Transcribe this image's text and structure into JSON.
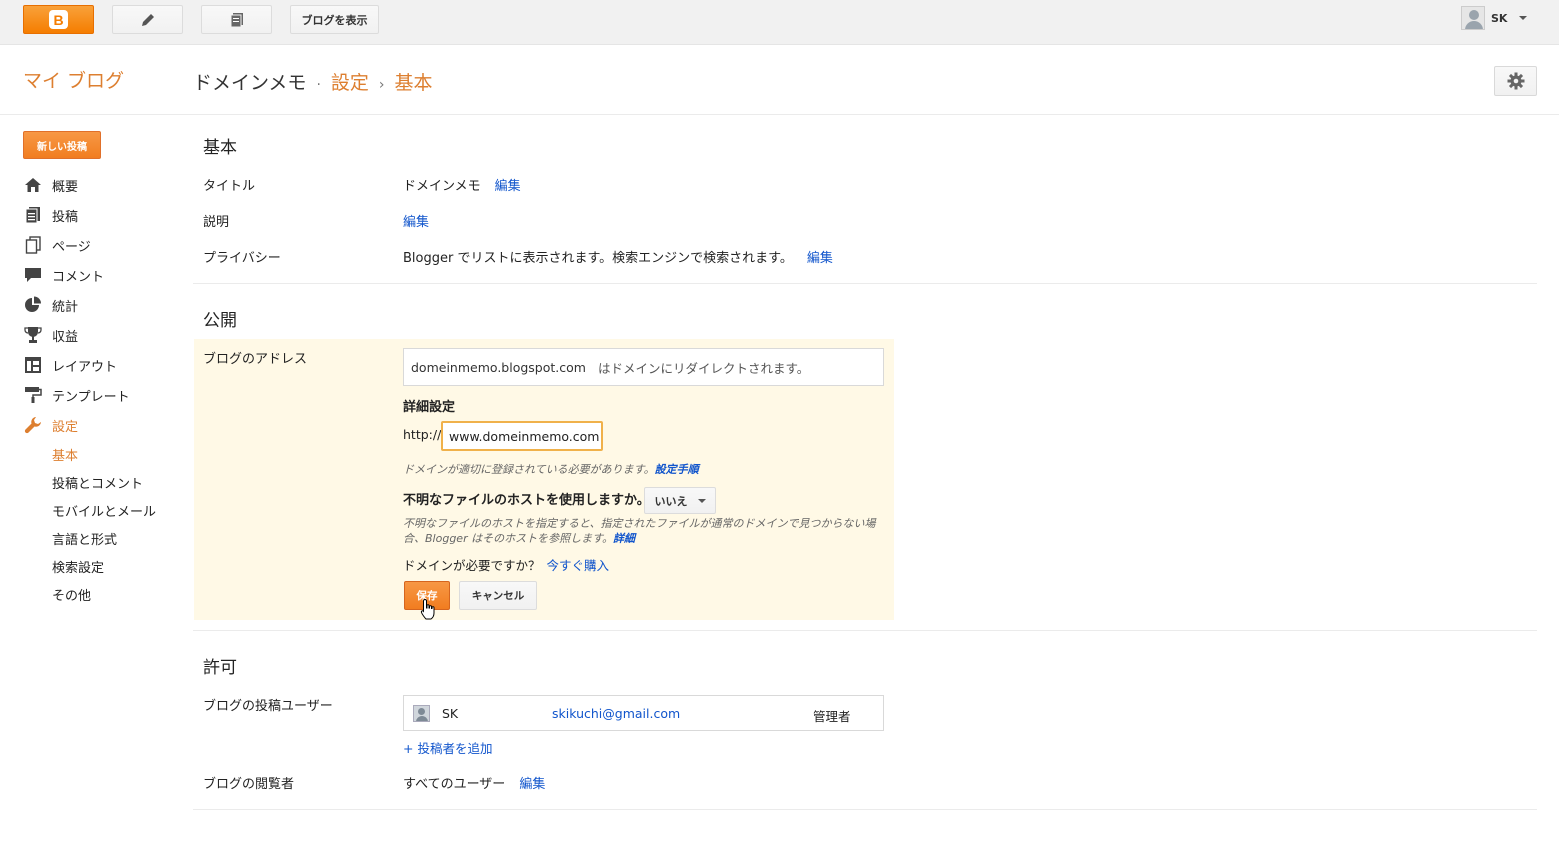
{
  "topbar": {
    "logo_letter": "B",
    "view_blog_label": "ブログを表示",
    "user_name": "SK"
  },
  "header": {
    "my_blog": "マイ ブログ",
    "blog_name": "ドメインメモ",
    "dot": "·",
    "settings": "設定",
    "arrow": "›",
    "current": "基本"
  },
  "sidebar": {
    "new_post": "新しい投稿",
    "items": [
      {
        "label": "概要",
        "icon": "home-icon"
      },
      {
        "label": "投稿",
        "icon": "posts-icon"
      },
      {
        "label": "ページ",
        "icon": "pages-icon"
      },
      {
        "label": "コメント",
        "icon": "comment-icon"
      },
      {
        "label": "統計",
        "icon": "stats-icon"
      },
      {
        "label": "収益",
        "icon": "trophy-icon"
      },
      {
        "label": "レイアウト",
        "icon": "layout-icon"
      },
      {
        "label": "テンプレート",
        "icon": "template-icon"
      },
      {
        "label": "設定",
        "icon": "wrench-icon"
      }
    ],
    "sub_items": [
      "基本",
      "投稿とコメント",
      "モバイルとメール",
      "言語と形式",
      "検索設定",
      "その他"
    ]
  },
  "basic": {
    "title": "基本",
    "title_label": "タイトル",
    "title_value": "ドメインメモ",
    "edit": "編集",
    "description_label": "説明",
    "privacy_label": "プライバシー",
    "privacy_value": "Blogger でリストに表示されます。検索エンジンで検索されます。"
  },
  "publish": {
    "title": "公開",
    "address_label": "ブログのアドレス",
    "address_value": "domeinmemo.blogspot.com",
    "address_note": "はドメインにリダイレクトされます。",
    "advanced": "詳細設定",
    "http": "http://",
    "domain_value": "www.domeinmemo.com",
    "hint": "ドメインが適切に登録されている必要があります。",
    "hint_link": "設定手順",
    "question": "不明なファイルのホストを使用しますか。",
    "select_value": "いいえ",
    "hint2": "不明なファイルのホストを指定すると、指定されたファイルが通常のドメインで見つからない場合、Blogger はそのホストを参照します。",
    "hint2_link": "詳細",
    "need_domain": "ドメインが必要ですか？",
    "buy_now": "今すぐ購入",
    "save": "保存",
    "cancel": "キャンセル"
  },
  "permissions": {
    "title": "許可",
    "authors_label": "ブログの投稿ユーザー",
    "author_name": "SK",
    "author_email": "skikuchi@gmail.com",
    "author_role": "管理者",
    "add_author": "+ 投稿者を追加",
    "readers_label": "ブログの閲覧者",
    "readers_value": "すべてのユーザー",
    "edit": "編集"
  }
}
